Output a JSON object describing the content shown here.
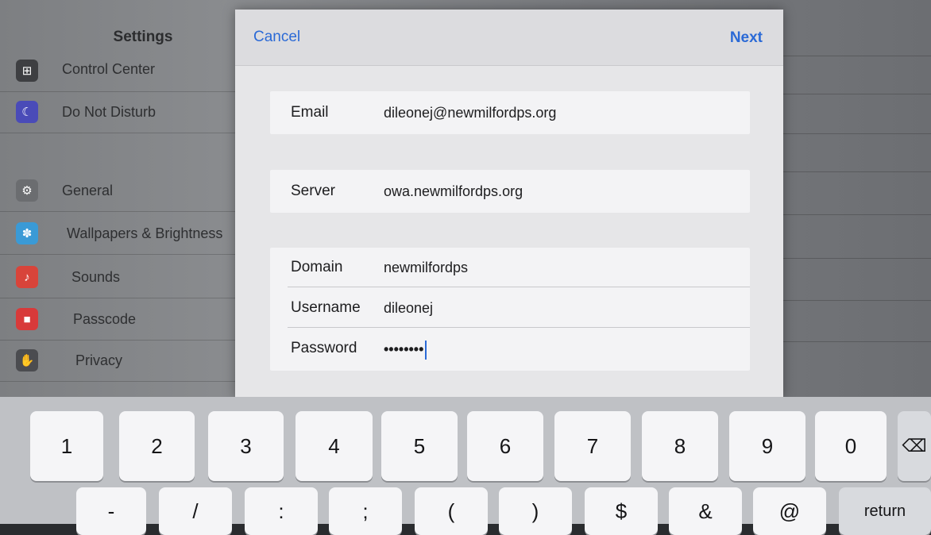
{
  "settings": {
    "title": "Settings",
    "items": [
      {
        "label": "Control Center",
        "icon": "control-center-icon",
        "color": "#3e3f42",
        "glyph": "⊞"
      },
      {
        "label": "Do Not Disturb",
        "icon": "moon-icon",
        "color": "#4a4bb8",
        "glyph": "☾"
      },
      {
        "label": "General",
        "icon": "gear-icon",
        "color": "#6b6d70",
        "glyph": "⚙"
      },
      {
        "label": "Wallpapers & Brightness",
        "icon": "wallpaper-icon",
        "color": "#3a9ad6",
        "glyph": "✽"
      },
      {
        "label": "Sounds",
        "icon": "speaker-icon",
        "color": "#d8443a",
        "glyph": "♪"
      },
      {
        "label": "Passcode",
        "icon": "lock-icon",
        "color": "#d83a3a",
        "glyph": "🔒"
      },
      {
        "label": "Privacy",
        "icon": "hand-icon",
        "color": "#4b4c50",
        "glyph": "✋"
      }
    ]
  },
  "modal": {
    "cancel_label": "Cancel",
    "next_label": "Next",
    "email": {
      "label": "Email",
      "value": "dileonej@newmilfordps.org"
    },
    "server": {
      "label": "Server",
      "value": "owa.newmilfordps.org"
    },
    "domain": {
      "label": "Domain",
      "value": "newmilfordps"
    },
    "username": {
      "label": "Username",
      "value": "dileonej"
    },
    "password": {
      "label": "Password",
      "value": "••••••••"
    }
  },
  "keyboard": {
    "row1": [
      "1",
      "2",
      "3",
      "4",
      "5",
      "6",
      "7",
      "8",
      "9",
      "0"
    ],
    "row2": [
      "-",
      "/",
      ":",
      ";",
      "(",
      ")",
      "$",
      "&",
      "@"
    ],
    "return_label": "return",
    "delete_icon": "backspace-icon"
  }
}
